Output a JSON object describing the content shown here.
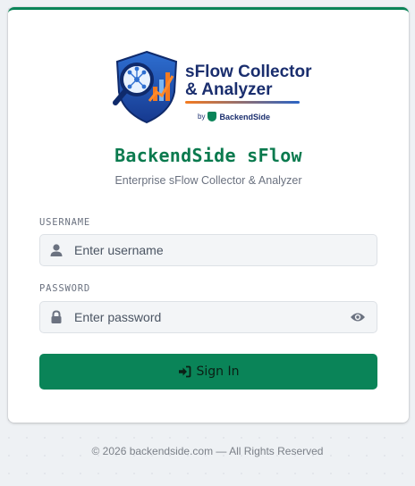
{
  "logo": {
    "title": "sFlow Collector",
    "subtitle": "& Analyzer",
    "by_prefix": "by",
    "by_brand": "BackendSide"
  },
  "header": {
    "title": "BackendSide sFlow",
    "subtitle": "Enterprise sFlow Collector & Analyzer"
  },
  "form": {
    "username": {
      "label": "USERNAME",
      "placeholder": "Enter username",
      "value": "",
      "icon": "user-icon"
    },
    "password": {
      "label": "PASSWORD",
      "placeholder": "Enter password",
      "value": "",
      "icon": "lock-icon",
      "toggle_icon": "eye-icon"
    },
    "submit_label": "Sign In",
    "submit_icon": "sign-in-icon"
  },
  "footer": {
    "text": "© 2026 backendside.com — All Rights Reserved"
  },
  "colors": {
    "accent": "#0a8458",
    "title": "#0a7a4e",
    "logo_navy": "#1a2e6e"
  }
}
